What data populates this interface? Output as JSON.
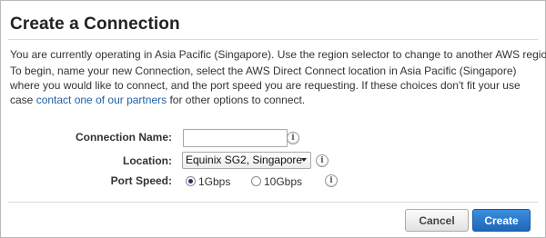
{
  "dialog": {
    "title": "Create a Connection",
    "intro_line": "You are currently operating in Asia Pacific (Singapore). Use the region selector to change to another AWS region.",
    "instructions_before_link": "To begin, name your new Connection, select the AWS Direct Connect location in Asia Pacific (Singapore) where you would like to connect, and the port speed you are requesting. If these choices don't fit your use case ",
    "partners_link": "contact one of our partners",
    "instructions_after_link": " for other options to connect."
  },
  "form": {
    "connection_name": {
      "label": "Connection Name:",
      "value": "",
      "info_icon": "info-icon"
    },
    "location": {
      "label": "Location:",
      "selected": "Equinix SG2, Singapore",
      "info_icon": "info-icon"
    },
    "port_speed": {
      "label": "Port Speed:",
      "options": [
        {
          "label": "1Gbps",
          "checked": true
        },
        {
          "label": "10Gbps",
          "checked": false
        }
      ],
      "info_icon": "info-icon"
    }
  },
  "buttons": {
    "cancel": "Cancel",
    "create": "Create"
  },
  "colors": {
    "link": "#1f5fa8",
    "primary_button": "#1e67b9",
    "border": "#b9b9b9"
  }
}
